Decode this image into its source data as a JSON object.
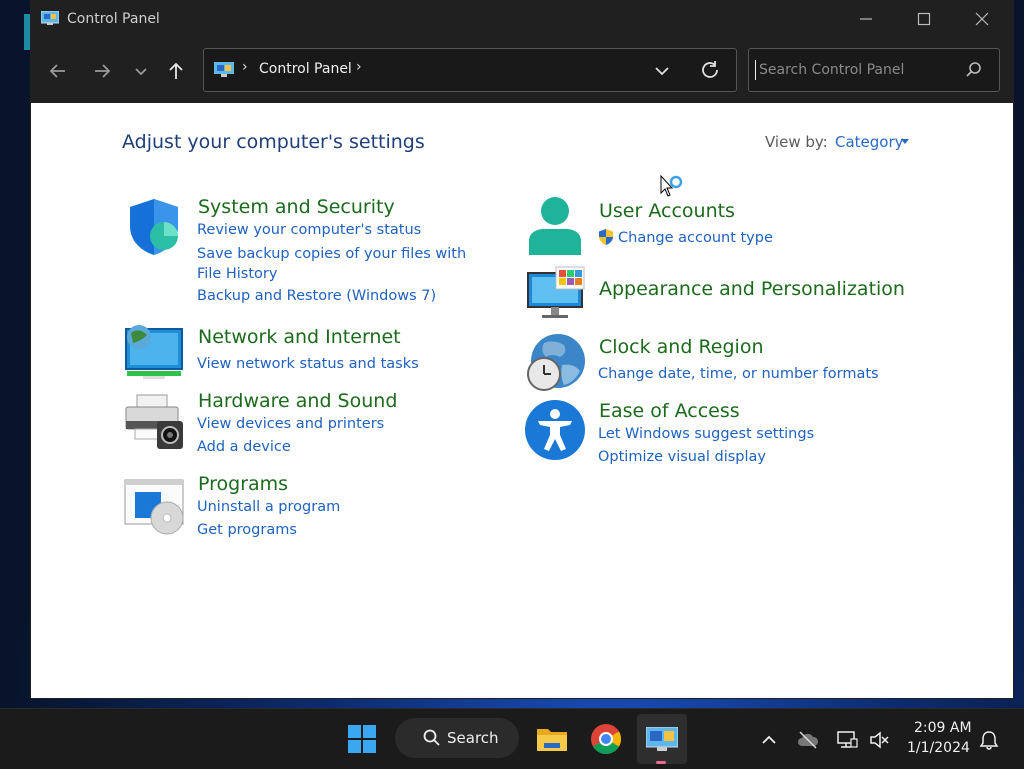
{
  "window": {
    "title": "Control Panel"
  },
  "address": {
    "sep": "›",
    "path": "Control Panel",
    "sep2": "›"
  },
  "search": {
    "placeholder": "Search Control Panel"
  },
  "content": {
    "title": "Adjust your computer's settings",
    "view_by_label": "View by:",
    "view_by_value": "Category"
  },
  "categories": [
    {
      "heading": "System and Security",
      "links": [
        "Review your computer's status",
        "Save backup copies of your files with File History",
        "Backup and Restore (Windows 7)"
      ]
    },
    {
      "heading": "Network and Internet",
      "links": [
        "View network status and tasks"
      ]
    },
    {
      "heading": "Hardware and Sound",
      "links": [
        "View devices and printers",
        "Add a device"
      ]
    },
    {
      "heading": "Programs",
      "links": [
        "Uninstall a program",
        "Get programs"
      ]
    },
    {
      "heading": "User Accounts",
      "links": [
        "Change account type"
      ]
    },
    {
      "heading": "Appearance and Personalization",
      "links": []
    },
    {
      "heading": "Clock and Region",
      "links": [
        "Change date, time, or number formats"
      ]
    },
    {
      "heading": "Ease of Access",
      "links": [
        "Let Windows suggest settings",
        "Optimize visual display"
      ]
    }
  ],
  "taskbar": {
    "search_label": "Search",
    "time": "2:09 AM",
    "date": "1/1/2024"
  },
  "colors": {
    "heading_green": "#1c6b1c",
    "link_blue": "#1f62c0",
    "title_blue": "#1e3f7a"
  }
}
